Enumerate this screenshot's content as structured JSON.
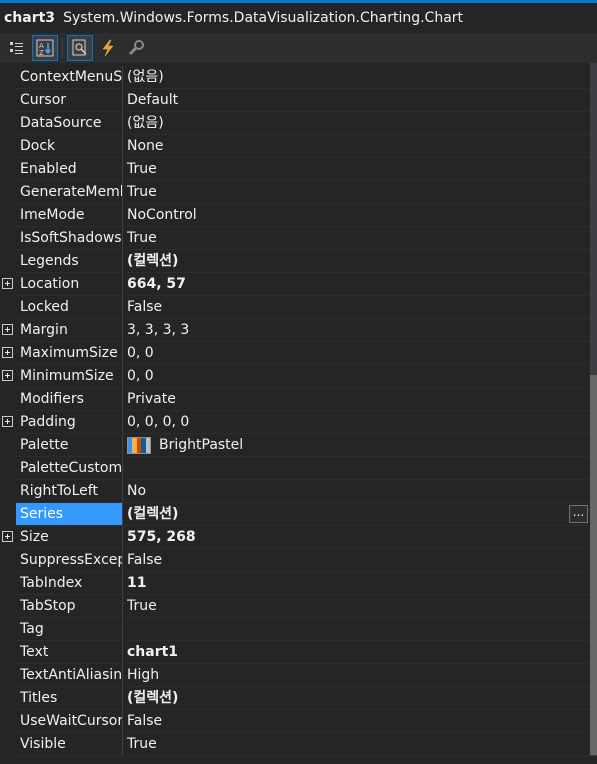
{
  "header": {
    "object_name": "chart3",
    "object_type": "System.Windows.Forms.DataVisualization.Charting.Chart"
  },
  "toolbar": {
    "buttons": [
      {
        "name": "categorized-icon",
        "active": false
      },
      {
        "name": "alphabetical-icon",
        "active": true
      },
      {
        "name": "properties-icon",
        "active": true
      },
      {
        "name": "events-lightning-icon",
        "active": false
      },
      {
        "name": "property-pages-wrench-icon",
        "active": false
      }
    ]
  },
  "properties": [
    {
      "name": "ContextMenuStrip",
      "value": "(없음)",
      "bold": false,
      "expandable": false
    },
    {
      "name": "Cursor",
      "value": "Default",
      "bold": false,
      "expandable": false
    },
    {
      "name": "DataSource",
      "value": "(없음)",
      "bold": false,
      "expandable": false
    },
    {
      "name": "Dock",
      "value": "None",
      "bold": false,
      "expandable": false
    },
    {
      "name": "Enabled",
      "value": "True",
      "bold": false,
      "expandable": false
    },
    {
      "name": "GenerateMemberOrder",
      "value": "True",
      "bold": false,
      "expandable": false
    },
    {
      "name": "ImeMode",
      "value": "NoControl",
      "bold": false,
      "expandable": false
    },
    {
      "name": "IsSoftShadows",
      "value": "True",
      "bold": false,
      "expandable": false
    },
    {
      "name": "Legends",
      "value": "(컬렉션)",
      "bold": true,
      "expandable": false
    },
    {
      "name": "Location",
      "value": "664, 57",
      "bold": true,
      "expandable": true
    },
    {
      "name": "Locked",
      "value": "False",
      "bold": false,
      "expandable": false
    },
    {
      "name": "Margin",
      "value": "3, 3, 3, 3",
      "bold": false,
      "expandable": true
    },
    {
      "name": "MaximumSize",
      "value": "0, 0",
      "bold": false,
      "expandable": true
    },
    {
      "name": "MinimumSize",
      "value": "0, 0",
      "bold": false,
      "expandable": true
    },
    {
      "name": "Modifiers",
      "value": "Private",
      "bold": false,
      "expandable": false
    },
    {
      "name": "Padding",
      "value": "0, 0, 0, 0",
      "bold": false,
      "expandable": true
    },
    {
      "name": "Palette",
      "value": "BrightPastel",
      "bold": false,
      "expandable": false,
      "swatch": true
    },
    {
      "name": "PaletteCustomColors",
      "value": "",
      "bold": false,
      "expandable": false
    },
    {
      "name": "RightToLeft",
      "value": "No",
      "bold": false,
      "expandable": false
    },
    {
      "name": "Series",
      "value": "(컬렉션)",
      "bold": true,
      "expandable": false,
      "selected": true,
      "ellipsis": "..."
    },
    {
      "name": "Size",
      "value": "575, 268",
      "bold": true,
      "expandable": true
    },
    {
      "name": "SuppressExceptions",
      "value": "False",
      "bold": false,
      "expandable": false
    },
    {
      "name": "TabIndex",
      "value": "11",
      "bold": true,
      "expandable": false
    },
    {
      "name": "TabStop",
      "value": "True",
      "bold": false,
      "expandable": false
    },
    {
      "name": "Tag",
      "value": "",
      "bold": false,
      "expandable": false
    },
    {
      "name": "Text",
      "value": "chart1",
      "bold": true,
      "expandable": false
    },
    {
      "name": "TextAntiAliasing",
      "value": "High",
      "bold": false,
      "expandable": false
    },
    {
      "name": "Titles",
      "value": "(컬렉션)",
      "bold": true,
      "expandable": false
    },
    {
      "name": "UseWaitCursor",
      "value": "False",
      "bold": false,
      "expandable": false
    },
    {
      "name": "Visible",
      "value": "True",
      "bold": false,
      "expandable": false
    }
  ],
  "palette_swatch_colors": [
    "#418CF0",
    "#FCB441",
    "#E0400A",
    "#056492",
    "#BFBFBF"
  ],
  "colors": {
    "background": "#252526",
    "selection": "#3399FF",
    "accent": "#007ACC"
  }
}
